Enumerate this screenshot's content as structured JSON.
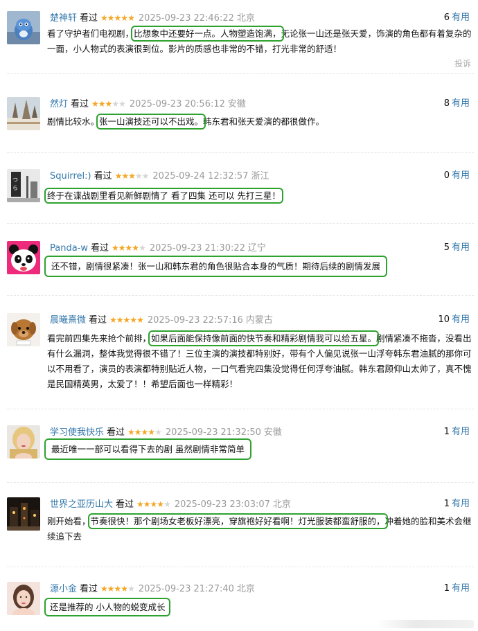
{
  "useful_word": "有用",
  "watched_word": "看过",
  "report_label": "投诉",
  "colors": {
    "link": "#3377aa",
    "star": "#f5a623",
    "highlight": "#2ea22e",
    "meta": "#9a9a9a"
  },
  "comments": [
    {
      "user": "楚神轩",
      "rating": 5,
      "time": "2025-09-23 22:46:22",
      "location": "北京",
      "useful": "6",
      "pre": "看了守护者们电视剧，",
      "hl": "比想象中还要好一点。人物塑造饱满，",
      "post": "无论张一山还是张天爱，饰演的角色都有着复杂的一面，小人物式的表演很到位。影片的质感也非常的不错，打光非常的舒适！",
      "avatar_icon": "blue-bird-avatar-icon"
    },
    {
      "user": "然灯",
      "rating": 3,
      "time": "2025-09-23 20:56:12",
      "location": "安徽",
      "useful": "8",
      "pre": "剧情比较水。",
      "hl": "张一山演技还可以不出戏。",
      "post": "韩东君和张天爱演的都很做作。",
      "avatar_icon": "snowy-trees-avatar-icon"
    },
    {
      "user": "Squirrel:)",
      "rating": 3,
      "time": "2025-09-24 12:32:57",
      "location": "浙江",
      "useful": "0",
      "pre": "",
      "hl": "终于在谍战剧里看见新鲜剧情了 看了四集 还可以 先打三星！",
      "post": "",
      "avatar_icon": "street-sign-avatar-icon"
    },
    {
      "user": "Panda-w",
      "rating": 4,
      "time": "2025-09-23 21:30:22",
      "location": "辽宁",
      "useful": "5",
      "pre": "",
      "hl": "还不错，剧情很紧凑！张一山和韩东君的角色很贴合本身的气质！期待后续的剧情发展",
      "post": "",
      "avatar_icon": "panda-avatar-icon"
    },
    {
      "user": "晨曦熹微",
      "rating": 5,
      "time": "2025-09-23 22:57:16",
      "location": "内蒙古",
      "useful": "10",
      "pre": "看完前四集先来抢个前排，",
      "hl": "如果后面能保持像前面的快节奏和精彩剧情我可以给五星。",
      "post": "剧情紧凑不拖沓，没看出有什么漏洞，整体我觉得很不错了！三位主演的演技都特别好，带有个人偏见说张一山浮夸韩东君油腻的那你可以不用看了，演员的表演都特别贴近人物，一口气看完四集没觉得任何浮夸油腻。韩东君顾仰山太帅了，真不愧是民国精英男，太爱了！！希望后面也一样精彩！",
      "avatar_icon": "puppy-avatar-icon"
    },
    {
      "user": "学习使我快乐",
      "rating": 4,
      "time": "2025-09-23 21:32:50",
      "location": "安徽",
      "useful": "1",
      "pre": "",
      "hl": "最近唯一一部可以看得下去的剧 虽然剧情非常简单",
      "post": "",
      "avatar_icon": "blonde-woman-avatar-icon"
    },
    {
      "user": "世界之亚历山大",
      "rating": 4,
      "time": "2025-09-23 23:03:07",
      "location": "北京",
      "useful": "1",
      "pre": "刚开始看，",
      "hl": "节奏很快！那个剧场女老板好漂亮，穿旗袍好好看啊！灯光服装都蛮舒服的，",
      "post": "冲着她的脸和美术会继续追下去",
      "avatar_icon": "night-city-avatar-icon"
    },
    {
      "user": "源小金",
      "rating": 4,
      "time": "2025-09-23 21:27:40",
      "location": "北京",
      "useful": "1",
      "pre": "",
      "hl": "还是推荐的 小人物的蜕变成长",
      "post": "",
      "avatar_icon": "girl-portrait-avatar-icon"
    }
  ]
}
